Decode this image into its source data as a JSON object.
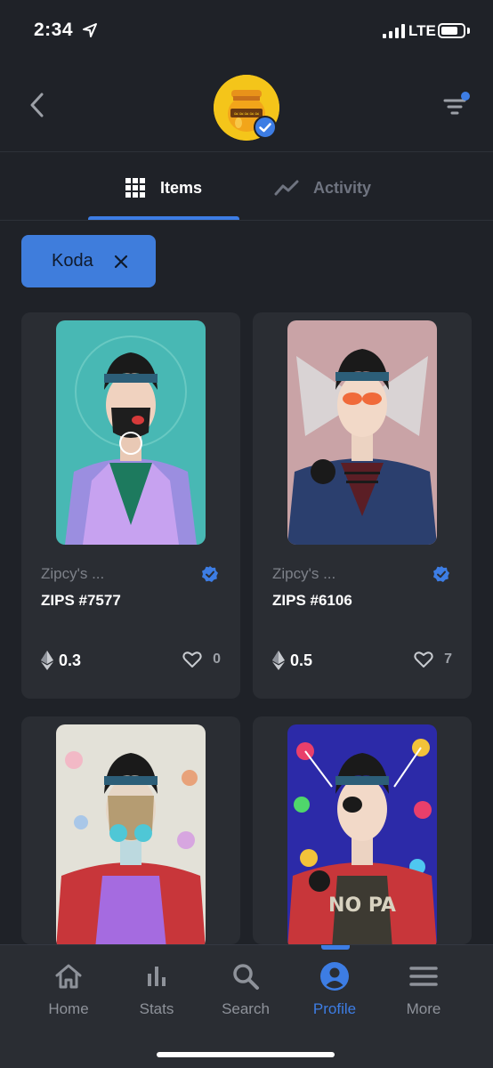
{
  "status_bar": {
    "time": "2:34",
    "network": "LTE"
  },
  "header": {
    "back_icon": "chevron-left-icon",
    "filter_icon": "filter-icon",
    "avatar": "honey-jar-avatar"
  },
  "tabs": [
    {
      "label": "Items",
      "icon": "grid-icon",
      "active": true
    },
    {
      "label": "Activity",
      "icon": "activity-line-icon",
      "active": false
    }
  ],
  "filter_chip": {
    "label": "Koda"
  },
  "cards": [
    {
      "collection": "Zipcy's ...",
      "name": "ZIPS #7577",
      "price": "0.3",
      "likes": "0"
    },
    {
      "collection": "Zipcy's ...",
      "name": "ZIPS #6106",
      "price": "0.5",
      "likes": "7"
    },
    {
      "collection": "",
      "name": "",
      "price": "",
      "likes": ""
    },
    {
      "collection": "",
      "name": "",
      "price": "",
      "likes": ""
    }
  ],
  "nav": [
    {
      "label": "Home",
      "icon": "home-icon"
    },
    {
      "label": "Stats",
      "icon": "stats-icon"
    },
    {
      "label": "Search",
      "icon": "search-icon"
    },
    {
      "label": "Profile",
      "icon": "profile-icon",
      "active": true
    },
    {
      "label": "More",
      "icon": "menu-icon"
    }
  ],
  "colors": {
    "background": "#1f2228",
    "card": "#2a2d33",
    "accent": "#3d7de4"
  }
}
